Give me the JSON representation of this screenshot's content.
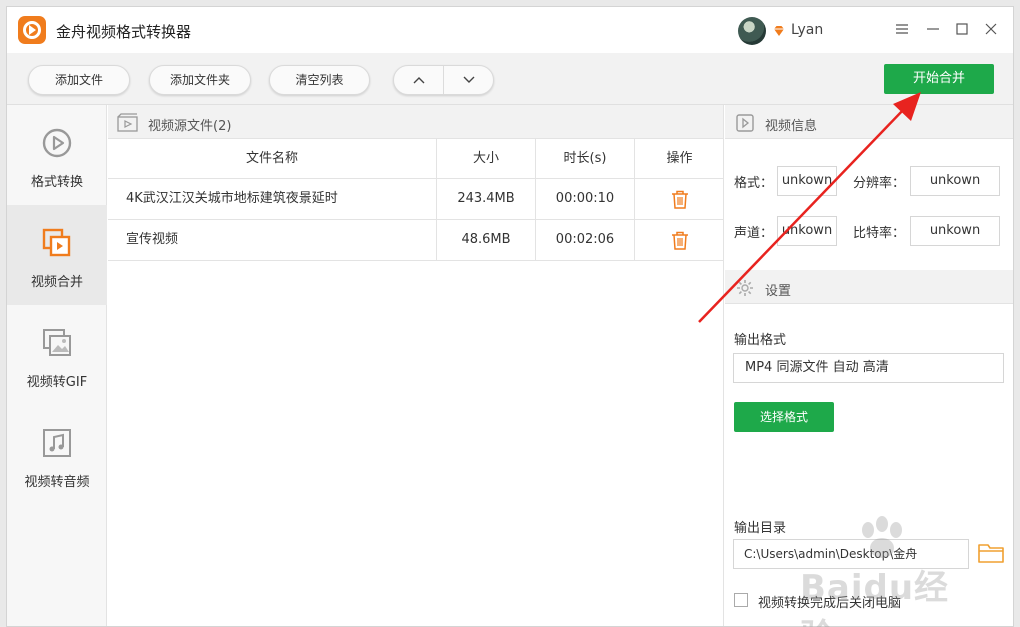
{
  "app": {
    "title": "金舟视频格式转换器",
    "username": "Lyan",
    "accent_color": "#1ea94a",
    "brand_color": "#f07c1d"
  },
  "toolbar": {
    "add_file": "添加文件",
    "add_folder": "添加文件夹",
    "clear_list": "清空列表",
    "start_merge": "开始合并"
  },
  "sidebar": {
    "items": [
      {
        "label": "格式转换",
        "icon": "play-circle-icon",
        "active": false
      },
      {
        "label": "视频合并",
        "icon": "video-merge-icon",
        "active": true
      },
      {
        "label": "视频转GIF",
        "icon": "image-icon",
        "active": false
      },
      {
        "label": "视频转音频",
        "icon": "music-note-icon",
        "active": false
      }
    ]
  },
  "file_panel": {
    "header": "视频源文件(2)",
    "columns": [
      "文件名称",
      "大小",
      "时长(s)",
      "操作"
    ],
    "rows": [
      {
        "name": "4K武汉江汉关城市地标建筑夜景延时",
        "size": "243.4MB",
        "duration": "00:00:10"
      },
      {
        "name": "宣传视频",
        "size": "48.6MB",
        "duration": "00:02:06"
      }
    ]
  },
  "video_info": {
    "header": "视频信息",
    "format_label": "格式：",
    "format_value": "unkown",
    "resolution_label": "分辨率：",
    "resolution_value": "unkown",
    "channel_label": "声道：",
    "channel_value": "unkown",
    "bitrate_label": "比特率：",
    "bitrate_value": "unkown"
  },
  "settings": {
    "header": "设置",
    "output_format_label": "输出格式",
    "output_format_value": "MP4 同源文件 自动 高清",
    "choose_format": "选择格式",
    "output_dir_label": "输出目录",
    "output_dir_value": "C:\\Users\\admin\\Desktop\\金舟",
    "open_after_label": "视频转换完成后关闭电脑"
  },
  "watermark": {
    "text": "Baidu经验"
  }
}
